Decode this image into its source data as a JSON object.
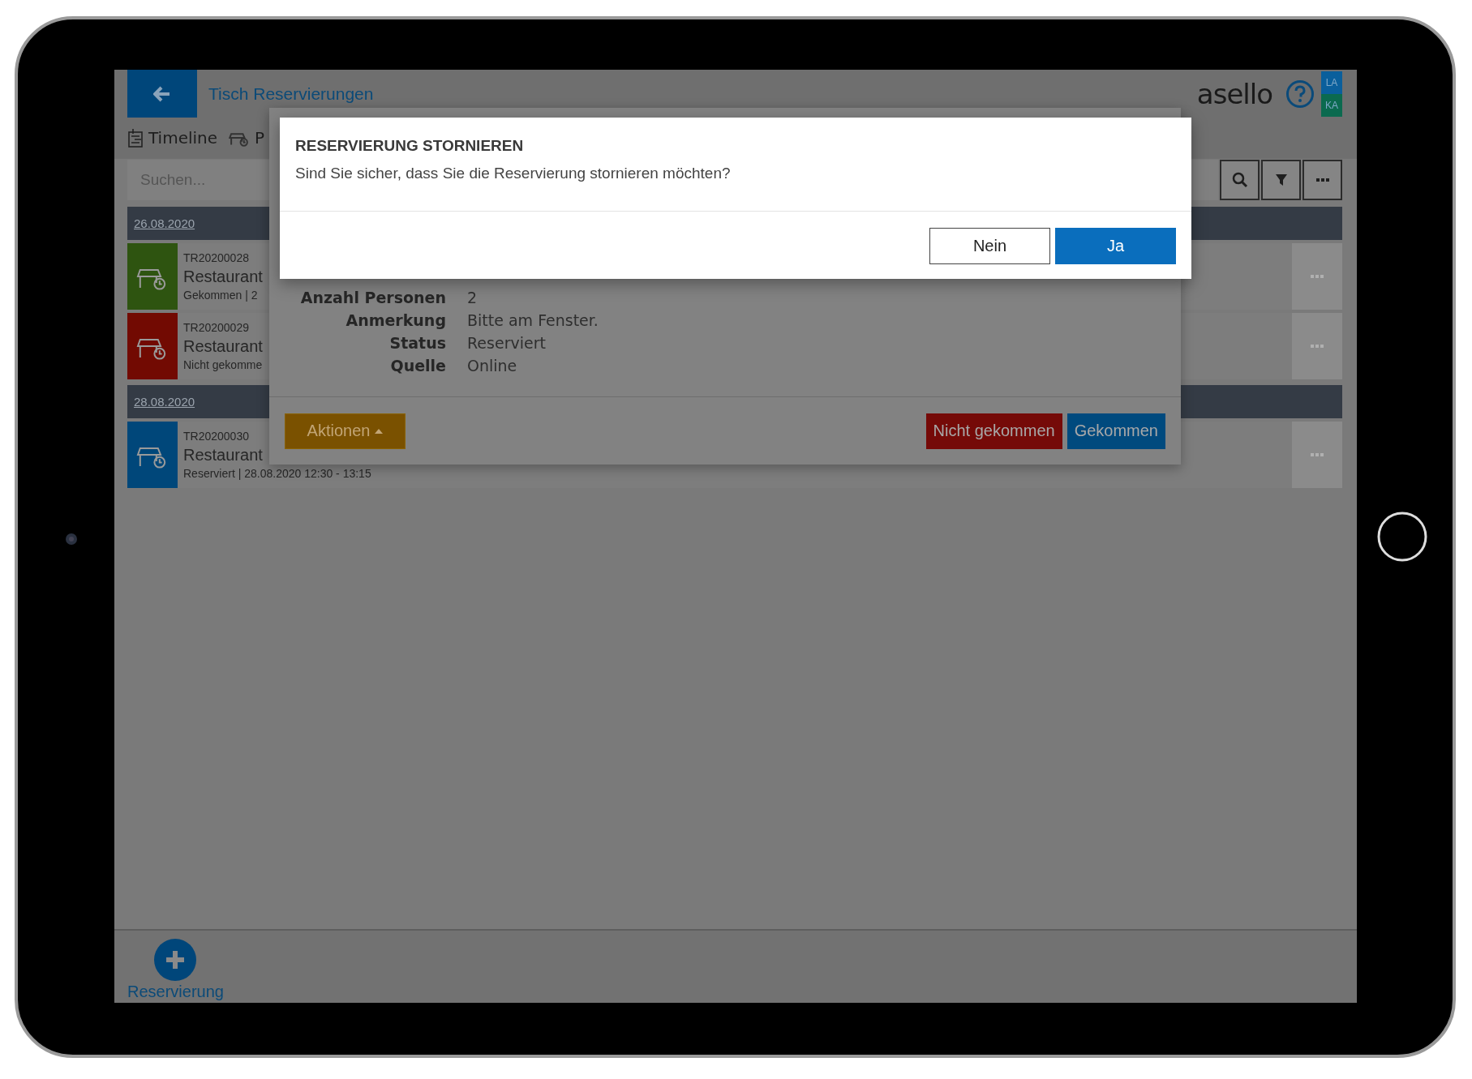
{
  "header": {
    "title": "Tisch Reservierungen",
    "logo": "asello",
    "user_badges": [
      {
        "text": "LA",
        "color": "#0a5f9c"
      },
      {
        "text": "KA",
        "color": "#0b6a4f"
      }
    ]
  },
  "tabs": [
    {
      "label": "Timeline",
      "kind": "timeline"
    },
    {
      "label": "P",
      "kind": "table"
    }
  ],
  "search": {
    "placeholder": "Suchen..."
  },
  "groups": [
    {
      "date": "26.08.2020",
      "reservations": [
        {
          "number": "TR20200028",
          "name": "Restaurant",
          "details": "Gekommen | 2",
          "color": "#2e5410"
        },
        {
          "number": "TR20200029",
          "name": "Restaurant",
          "details": "Nicht gekomme",
          "color": "#720a02"
        }
      ]
    },
    {
      "date": "28.08.2020",
      "reservations": [
        {
          "number": "TR20200030",
          "name": "Restaurant",
          "details": "Reserviert | 28.08.2020 12:30 - 13:15",
          "color": "#00477a"
        }
      ]
    }
  ],
  "detail": {
    "fields": [
      {
        "label": "Anzahl Personen",
        "value": "2"
      },
      {
        "label": "Anmerkung",
        "value": "Bitte am Fenster."
      },
      {
        "label": "Status",
        "value": "Reserviert"
      },
      {
        "label": "Quelle",
        "value": "Online"
      }
    ],
    "actions_button": "Aktionen",
    "buttons": [
      {
        "label": "Nicht gekommen",
        "kind": "danger"
      },
      {
        "label": "Gekommen",
        "kind": "primary"
      }
    ]
  },
  "confirm": {
    "title": "RESERVIERUNG STORNIEREN",
    "message": "Sind Sie sicher, dass Sie die Reservierung stornieren möchten?",
    "buttons": [
      {
        "label": "Nein",
        "kind": "secondary"
      },
      {
        "label": "Ja",
        "kind": "primary"
      }
    ]
  },
  "bottom_bar": {
    "add_label": "Reservierung"
  }
}
